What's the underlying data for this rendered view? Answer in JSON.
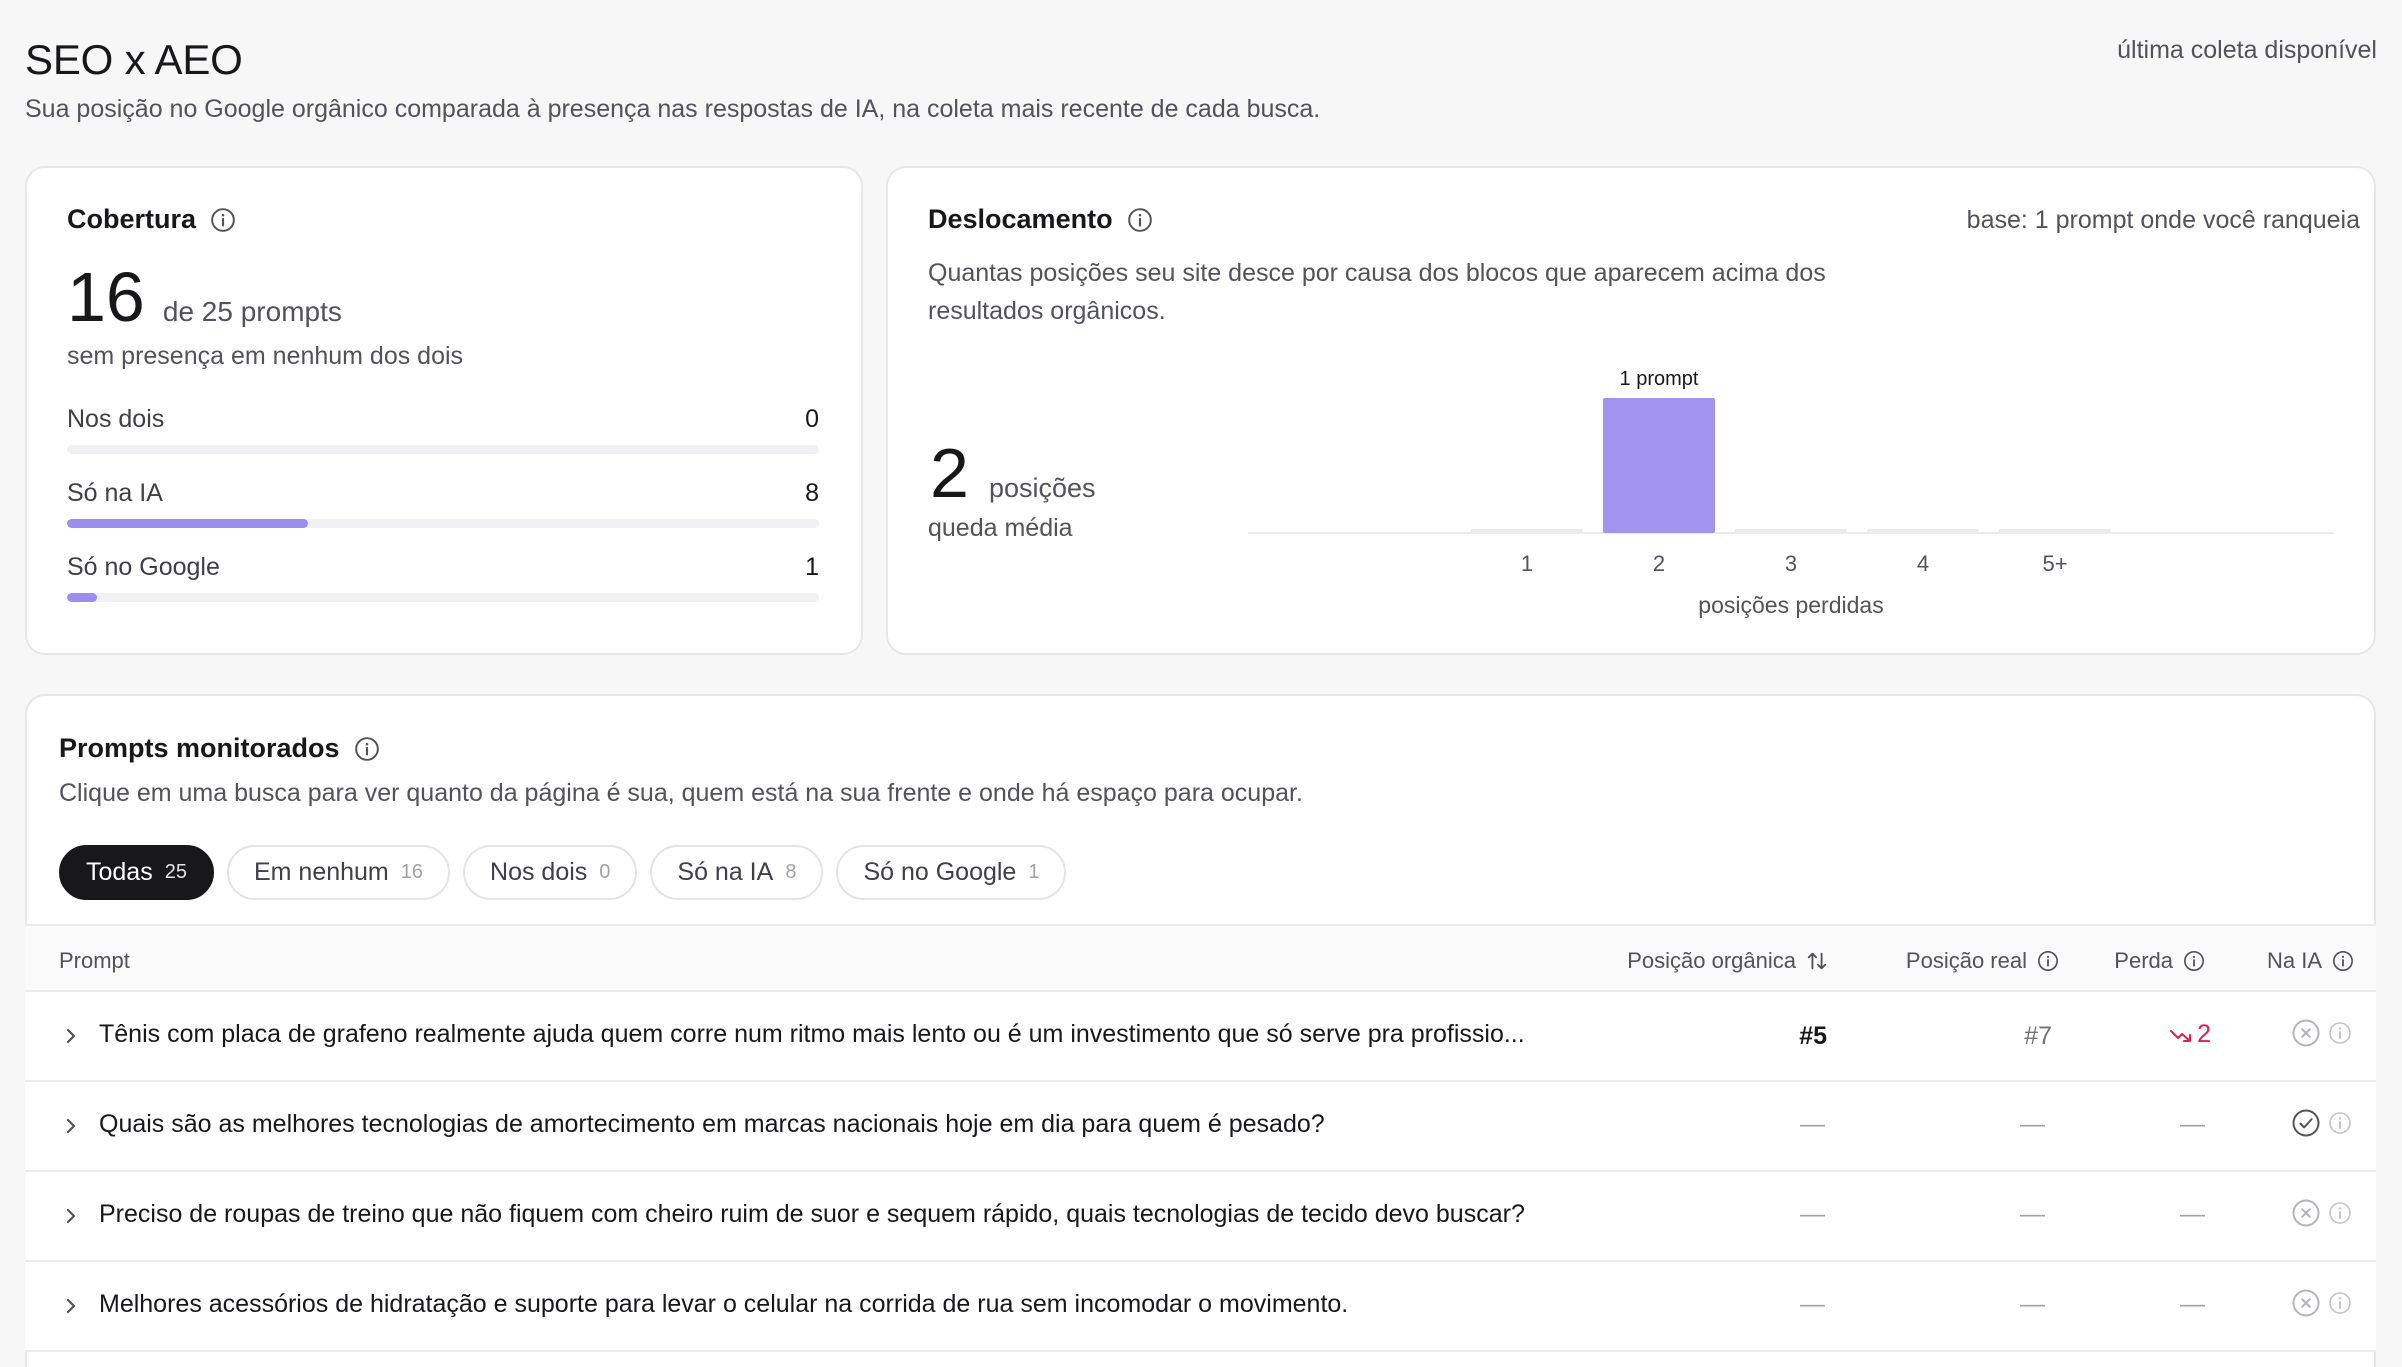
{
  "header": {
    "title": "SEO x AEO",
    "subtitle": "Sua posição no Google orgânico comparada à presença nas respostas de IA, na coleta mais recente de cada busca.",
    "collect_label": "última coleta disponível"
  },
  "coverage": {
    "title": "Cobertura",
    "big_number": "16",
    "of_label": "de 25 prompts",
    "subtitle": "sem presença em nenhum dos dois",
    "bars": [
      {
        "label": "Nos dois",
        "value": "0",
        "fraction": 0
      },
      {
        "label": "Só na IA",
        "value": "8",
        "fraction": 0.32
      },
      {
        "label": "Só no Google",
        "value": "1",
        "fraction": 0.04
      }
    ]
  },
  "displacement": {
    "title": "Deslocamento",
    "base": "base: 1 prompt onde você ranqueia",
    "description": "Quantas posições seu site desce por causa dos blocos que aparecem acima dos resultados orgânicos.",
    "big_number": "2",
    "unit": "posições",
    "subtitle": "queda média"
  },
  "chart_data": {
    "type": "bar",
    "categories": [
      "1",
      "2",
      "3",
      "4",
      "5+"
    ],
    "values": [
      0,
      1,
      0,
      0,
      0
    ],
    "data_labels": [
      "",
      "1 prompt",
      "",
      "",
      ""
    ],
    "xlabel": "posições perdidas",
    "ylabel": "",
    "ylim": [
      0,
      1
    ],
    "color": "#a193ee",
    "empty_color": "#ececef"
  },
  "prompts": {
    "title": "Prompts monitorados",
    "description": "Clique em uma busca para ver quanto da página é sua, quem está na sua frente e onde há espaço para ocupar.",
    "chips": [
      {
        "label": "Todas",
        "count": "25",
        "active": true
      },
      {
        "label": "Em nenhum",
        "count": "16",
        "active": false
      },
      {
        "label": "Nos dois",
        "count": "0",
        "active": false
      },
      {
        "label": "Só na IA",
        "count": "8",
        "active": false
      },
      {
        "label": "Só no Google",
        "count": "1",
        "active": false
      }
    ],
    "columns": {
      "prompt": "Prompt",
      "organic": "Posição orgânica",
      "real": "Posição real",
      "loss": "Perda",
      "ia": "Na IA"
    },
    "rows": [
      {
        "text": "Tênis com placa de grafeno realmente ajuda quem corre num ritmo mais lento ou é um investimento que só serve pra profissio...",
        "organic": "#5",
        "real": "#7",
        "loss": "2",
        "ia": "absent"
      },
      {
        "text": "Quais são as melhores tecnologias de amortecimento em marcas nacionais hoje em dia para quem é pesado?",
        "organic": "—",
        "real": "—",
        "loss": "—",
        "ia": "present"
      },
      {
        "text": "Preciso de roupas de treino que não fiquem com cheiro ruim de suor e sequem rápido, quais tecnologias de tecido devo buscar?",
        "organic": "—",
        "real": "—",
        "loss": "—",
        "ia": "absent"
      },
      {
        "text": "Melhores acessórios de hidratação e suporte para levar o celular na corrida de rua sem incomodar o movimento.",
        "organic": "—",
        "real": "—",
        "loss": "—",
        "ia": "absent"
      }
    ]
  }
}
